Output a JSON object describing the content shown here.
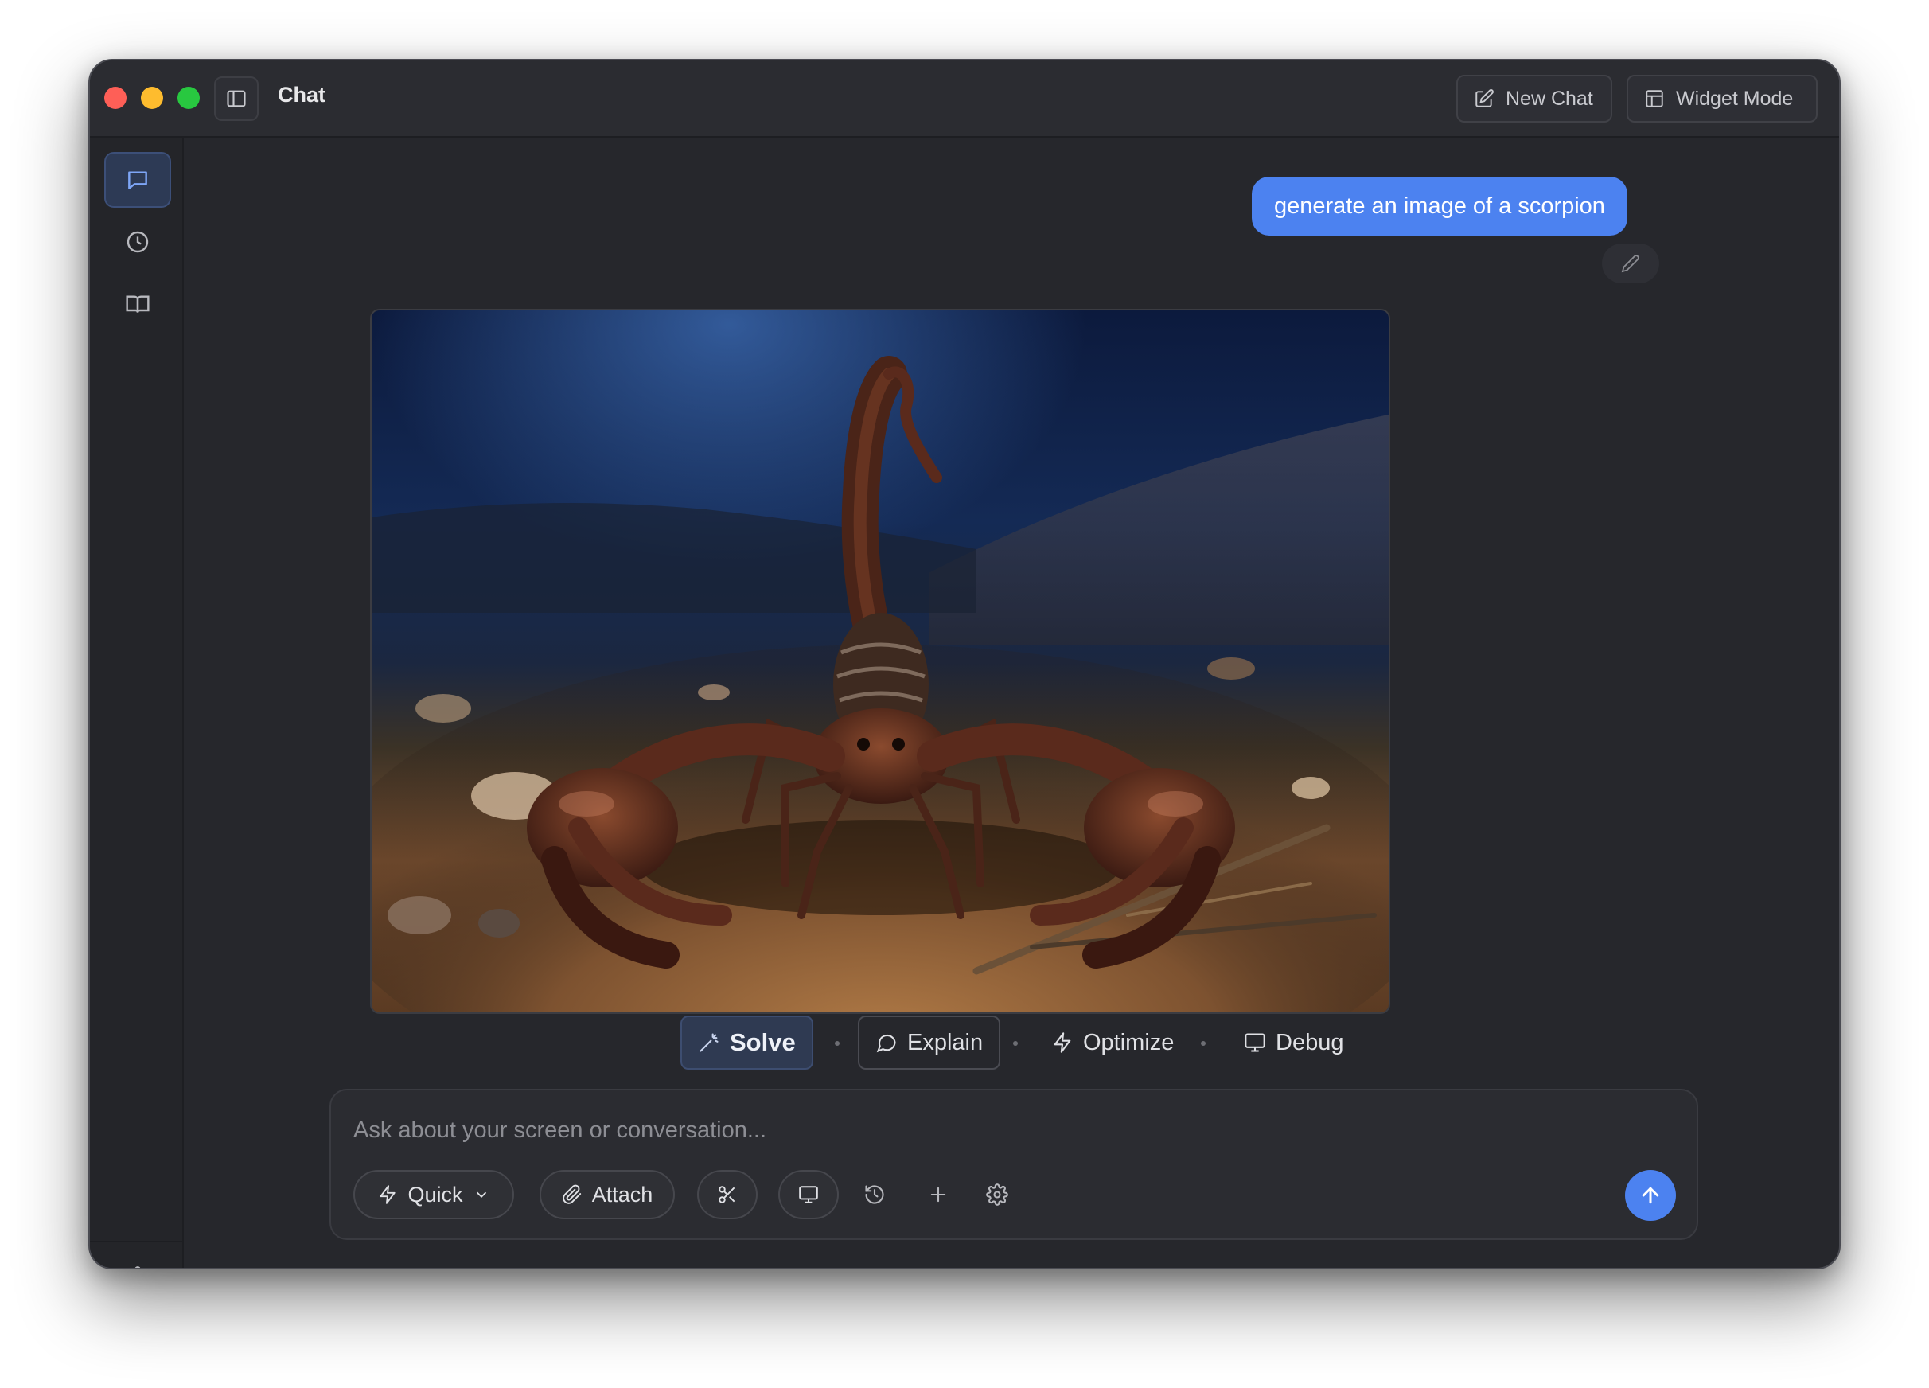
{
  "window": {
    "title": "Chat"
  },
  "toolbar": {
    "new_chat_label": "New Chat",
    "widget_mode_label": "Widget Mode"
  },
  "sidebar": {
    "items": [
      {
        "name": "chat",
        "icon": "chat-bubble-icon",
        "active": true
      },
      {
        "name": "history",
        "icon": "clock-icon",
        "active": false
      },
      {
        "name": "library",
        "icon": "book-icon",
        "active": false
      }
    ],
    "settings_icon": "gear-icon"
  },
  "conversation": {
    "user_message": "generate an image of a scorpion",
    "generated_image_subject": "scorpion"
  },
  "actions": {
    "solve_label": "Solve",
    "explain_label": "Explain",
    "optimize_label": "Optimize",
    "debug_label": "Debug"
  },
  "composer": {
    "placeholder": "Ask about your screen or conversation...",
    "value": "",
    "mode_label": "Quick",
    "attach_label": "Attach"
  },
  "colors": {
    "accent": "#4c82f0",
    "window_bg": "#26272c",
    "titlebar_bg": "#2b2c31"
  }
}
